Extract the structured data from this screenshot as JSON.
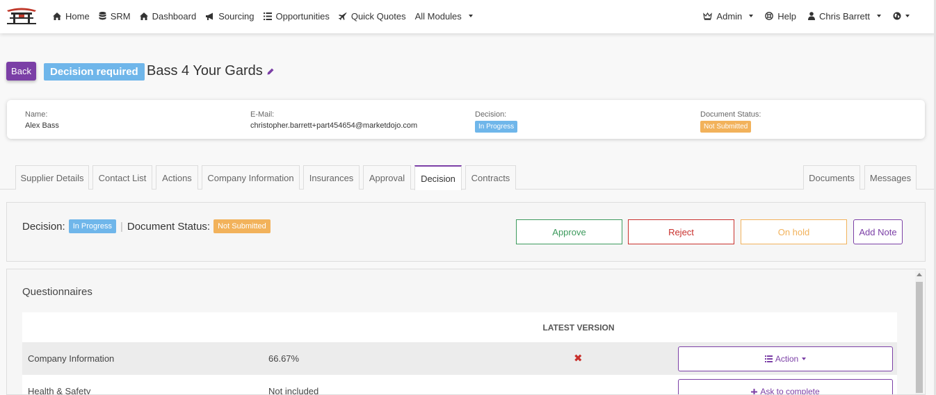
{
  "nav": {
    "left": [
      {
        "label": "Home",
        "icon": "home-icon"
      },
      {
        "label": "SRM",
        "icon": "database-icon"
      },
      {
        "label": "Dashboard",
        "icon": "home-icon"
      },
      {
        "label": "Sourcing",
        "icon": "bullhorn-icon"
      },
      {
        "label": "Opportunities",
        "icon": "list-icon"
      },
      {
        "label": "Quick Quotes",
        "icon": "plane-icon"
      },
      {
        "label": "All Modules",
        "icon": ""
      }
    ],
    "admin": "Admin",
    "help": "Help",
    "user": "Chris Barrett"
  },
  "header": {
    "back_label": "Back",
    "status_badge": "Decision required",
    "title": "Bass 4 Your Gards"
  },
  "summary": {
    "name_label": "Name:",
    "name_value": "Alex Bass",
    "email_label": "E-Mail:",
    "email_value": "christopher.barrett+part454654@marketdojo.com",
    "decision_label": "Decision:",
    "decision_value": "In Progress",
    "doc_label": "Document Status:",
    "doc_value": "Not Submitted"
  },
  "tabs": {
    "supplier_details": "Supplier Details",
    "contact_list": "Contact List",
    "actions": "Actions",
    "company_information": "Company Information",
    "insurances": "Insurances",
    "approval": "Approval",
    "decision": "Decision",
    "contracts": "Contracts",
    "documents": "Documents",
    "messages": "Messages"
  },
  "decision_panel": {
    "decision_label": "Decision:",
    "decision_value": "In Progress",
    "separator": "|",
    "doc_label": "Document Status:",
    "doc_value": "Not Submitted",
    "approve": "Approve",
    "reject": "Reject",
    "on_hold": "On hold",
    "add_note": "Add Note"
  },
  "questionnaires": {
    "title": "Questionnaires",
    "col_latest_version": "LATEST VERSION",
    "rows": [
      {
        "name": "Company Information",
        "value": "66.67%",
        "latest": "✖",
        "action": "Action"
      },
      {
        "name": "Health & Safety",
        "value": "Not included",
        "latest": "",
        "action": "Ask to complete"
      }
    ]
  },
  "colors": {
    "brand_purple": "#7b3fa6",
    "badge_blue": "#6fb6ea",
    "badge_orange": "#f2b25b",
    "approve_green": "#3c9a5c",
    "reject_red": "#c9302c"
  }
}
